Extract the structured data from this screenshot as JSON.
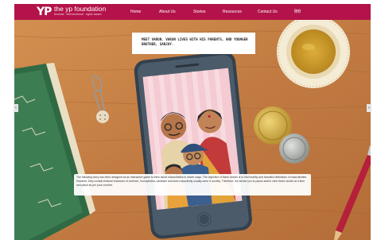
{
  "nav": {
    "logo_mark": "YP",
    "brand_name": "the yp foundation",
    "tagline": "feminist · intersectional · rights based",
    "links": [
      "Home",
      "About Us",
      "Stories",
      "Resources",
      "Contact Us",
      "हिंदी"
    ]
  },
  "story": {
    "caption": "MEET VARUN. VARUN LIVES WITH HIS PARENTS, AND YOUNGER BROTHER, SANJAY.",
    "description": "The following story has been designed as an interactive game to think about masculinities in newer ways. The objective of these stories is to find healthy and beautiful definitions of masculinities. However, they contain fictional instances of violence, homophobia, casteism and toxic masculinity usually seen in society. Therefore, we advise you to pause and/or view these stories at a time and place as per your comfort."
  },
  "carousel": {
    "prev_glyph": "‹",
    "next_glyph": "›"
  },
  "colors": {
    "nav_bg": "#b3134a",
    "table_wood": "#c9854a",
    "phone_body": "#3a4a5a"
  }
}
